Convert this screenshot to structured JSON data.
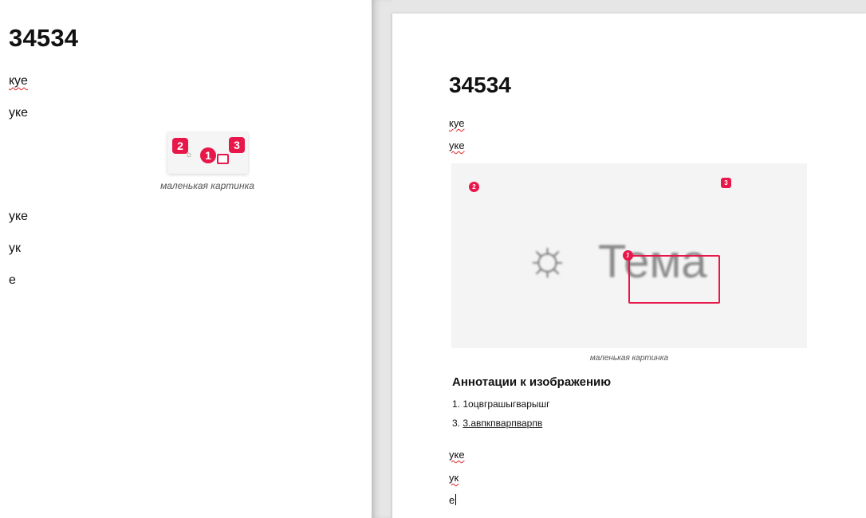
{
  "editor": {
    "title": "34534",
    "paragraphs_before": [
      "кye",
      "уке"
    ],
    "image": {
      "markers": [
        "1",
        "2",
        "3"
      ],
      "caption": "маленькая картинка"
    },
    "paragraphs_after": [
      "уке",
      "ук",
      "е"
    ]
  },
  "preview": {
    "title": "34534",
    "paragraphs_before": [
      "куе",
      "уке"
    ],
    "image": {
      "icon_word": "Тема",
      "markers": [
        "1",
        "2",
        "3"
      ],
      "caption": "маленькая картинка"
    },
    "annotations": {
      "heading": "Аннотации к изображению",
      "items": [
        {
          "number": "1.",
          "text": "1оцвграшыгварышг",
          "link": false
        },
        {
          "number": "3.",
          "text": "3.авпкпварпварпв",
          "link": true
        }
      ]
    },
    "paragraphs_after": [
      "уке",
      "ук",
      "е"
    ]
  },
  "colors": {
    "marker": "#e8174a",
    "gap": "#e6e6e6"
  },
  "icons": {
    "editor_sun": "sun-icon",
    "editor_camera": "camera-icon",
    "preview_sun": "sun-icon"
  }
}
